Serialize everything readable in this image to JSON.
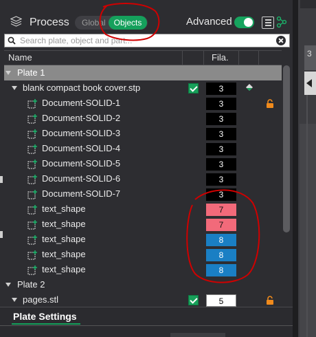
{
  "header": {
    "title": "Process",
    "mode_global": "Global",
    "mode_objects": "Objects",
    "advanced_label": "Advanced",
    "advanced_on": true
  },
  "search": {
    "placeholder": "Search plate, object and part..."
  },
  "columns": {
    "name": "Name",
    "filament": "Fila."
  },
  "tree": [
    {
      "type": "plate",
      "label": "Plate 1",
      "selected": true
    },
    {
      "type": "object",
      "label": "blank compact book cover.stp",
      "filament": "3",
      "checked": true,
      "paint_icon": true
    },
    {
      "type": "part",
      "label": "Document-SOLID-1",
      "filament": "3",
      "locked": true
    },
    {
      "type": "part",
      "label": "Document-SOLID-2",
      "filament": "3"
    },
    {
      "type": "part",
      "label": "Document-SOLID-3",
      "filament": "3"
    },
    {
      "type": "part",
      "label": "Document-SOLID-4",
      "filament": "3"
    },
    {
      "type": "part",
      "label": "Document-SOLID-5",
      "filament": "3"
    },
    {
      "type": "part",
      "label": "Document-SOLID-6",
      "filament": "3"
    },
    {
      "type": "part",
      "label": "Document-SOLID-7",
      "filament": "3"
    },
    {
      "type": "part",
      "label": "text_shape",
      "filament": "7",
      "filament_color": "#f26a7a"
    },
    {
      "type": "part",
      "label": "text_shape",
      "filament": "7",
      "filament_color": "#f26a7a"
    },
    {
      "type": "part",
      "label": "text_shape",
      "filament": "8",
      "filament_color": "#1a7fc4"
    },
    {
      "type": "part",
      "label": "text_shape",
      "filament": "8",
      "filament_color": "#1a7fc4"
    },
    {
      "type": "part",
      "label": "text_shape",
      "filament": "8",
      "filament_color": "#1a7fc4"
    },
    {
      "type": "plate",
      "label": "Plate 2"
    },
    {
      "type": "object",
      "label": "pages.stl",
      "filament": "5",
      "checked": true,
      "locked": true
    }
  ],
  "plate_settings": {
    "label": "Plate Settings"
  },
  "right_strip": {
    "number": "3"
  },
  "colors": {
    "accent": "#15a05c",
    "annotation": "#d00000"
  }
}
